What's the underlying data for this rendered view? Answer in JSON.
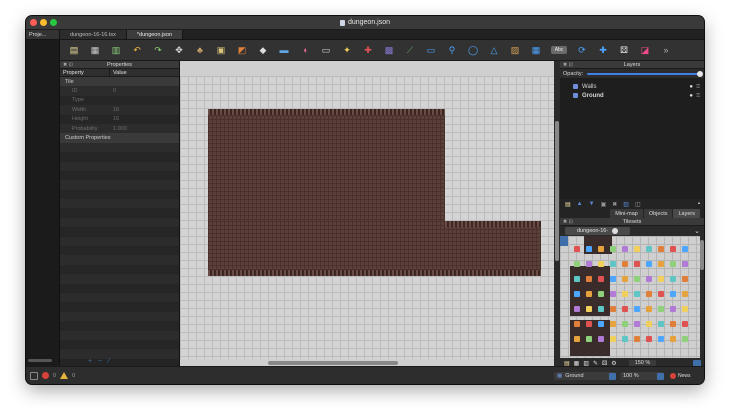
{
  "window": {
    "title": "dungeon.json"
  },
  "tabs": [
    {
      "label": "Proje...",
      "active": true
    },
    {
      "label": "dungeon-16-16.tsx",
      "active": false
    },
    {
      "label": "*dungeon.json",
      "active": true
    }
  ],
  "toolbar": {
    "tools": [
      {
        "icon": "new-icon",
        "glyph": "▤",
        "color": "#f2e1a0"
      },
      {
        "icon": "save-icon",
        "glyph": "▦",
        "color": "#cfcfcf"
      },
      {
        "icon": "export-icon",
        "glyph": "▥",
        "color": "#8fd07a"
      },
      {
        "icon": "undo-icon",
        "glyph": "↶",
        "color": "#f2b547"
      },
      {
        "icon": "redo-icon",
        "glyph": "↷",
        "color": "#8fd07a"
      },
      {
        "icon": "stamp-brush-icon",
        "glyph": "✥",
        "color": "#dddddd"
      },
      {
        "icon": "terrain-brush-icon",
        "glyph": "♣",
        "color": "#c9a36b"
      },
      {
        "icon": "random-mode-icon",
        "glyph": "▣",
        "color": "#d9c47a"
      },
      {
        "icon": "wfc-icon",
        "glyph": "◩",
        "color": "#e07f3a"
      },
      {
        "icon": "bucket-fill-icon",
        "glyph": "◆",
        "color": "#dddddd"
      },
      {
        "icon": "shape-fill-icon",
        "glyph": "▬",
        "color": "#5fa6e6"
      },
      {
        "icon": "eraser-icon",
        "glyph": "◖",
        "color": "#e76a8a"
      },
      {
        "icon": "rect-select-icon",
        "glyph": "▭",
        "color": "#dddddd"
      },
      {
        "icon": "magic-wand-icon",
        "glyph": "✦",
        "color": "#f0cf5b"
      },
      {
        "icon": "select-same-icon",
        "glyph": "✚",
        "color": "#e05252"
      },
      {
        "icon": "object-select-icon",
        "glyph": "▩",
        "color": "#8a7ad6"
      },
      {
        "icon": "edit-polygon-icon",
        "glyph": "⟋",
        "color": "#5aa86b"
      },
      {
        "icon": "insert-rectangle-icon",
        "glyph": "▭",
        "color": "#4da6ff"
      },
      {
        "icon": "insert-point-icon",
        "glyph": "⚲",
        "color": "#4da6ff"
      },
      {
        "icon": "insert-ellipse-icon",
        "glyph": "◯",
        "color": "#4da6ff"
      },
      {
        "icon": "insert-polygon-icon",
        "glyph": "△",
        "color": "#4da6ff"
      },
      {
        "icon": "insert-tile-icon",
        "glyph": "▨",
        "color": "#d9a45b"
      },
      {
        "icon": "insert-template-icon",
        "glyph": "▦",
        "color": "#4da6ff"
      },
      {
        "icon": "insert-text-icon",
        "glyph": "▭",
        "color": "#bbbbbb"
      },
      {
        "icon": "rotate-icon",
        "glyph": "⟳",
        "color": "#4da6ff"
      },
      {
        "icon": "flip-icon",
        "glyph": "✚",
        "color": "#4da6ff"
      },
      {
        "icon": "dice-icon",
        "glyph": "⚄",
        "color": "#e8e8e8"
      },
      {
        "icon": "color-picker-icon",
        "glyph": "◪",
        "color": "#f04a8a"
      },
      {
        "icon": "more-icon",
        "glyph": "»",
        "color": "#aaaaaa"
      }
    ],
    "text_tool_label": "Abc"
  },
  "properties": {
    "title": "Properties",
    "col_property": "Property",
    "col_value": "Value",
    "groups": [
      {
        "name": "Tile",
        "rows": [
          {
            "key": "ID",
            "value": "0"
          },
          {
            "key": "Type",
            "value": ""
          },
          {
            "key": "Width",
            "value": "16"
          },
          {
            "key": "Height",
            "value": "16"
          },
          {
            "key": "Probability",
            "value": "1.000"
          }
        ]
      },
      {
        "name": "Custom Properties",
        "rows": []
      }
    ],
    "footer_add": "+",
    "footer_remove": "−",
    "footer_edit": "⁄"
  },
  "layers": {
    "title": "Layers",
    "opacity_label": "Opacity:",
    "opacity_value": 1.0,
    "items": [
      {
        "name": "Walls",
        "visible": true
      },
      {
        "name": "Ground",
        "visible": true
      }
    ],
    "tabs": [
      "Mini-map",
      "Objects",
      "Layers"
    ]
  },
  "tilesets": {
    "title": "Tilesets",
    "active_tab": "dungeon-16-",
    "zoom": "150 %",
    "bottom_tabs": [
      "Terrains",
      "Tilesets"
    ]
  },
  "status": {
    "errors": "0",
    "warnings": "0",
    "current_layer": "Ground",
    "zoom": "100 %",
    "news_label": "News"
  },
  "colors": {
    "accent": "#3f6ea8",
    "brick": "#5b3f3a",
    "error": "#d8423a",
    "warning": "#e3b33c"
  }
}
